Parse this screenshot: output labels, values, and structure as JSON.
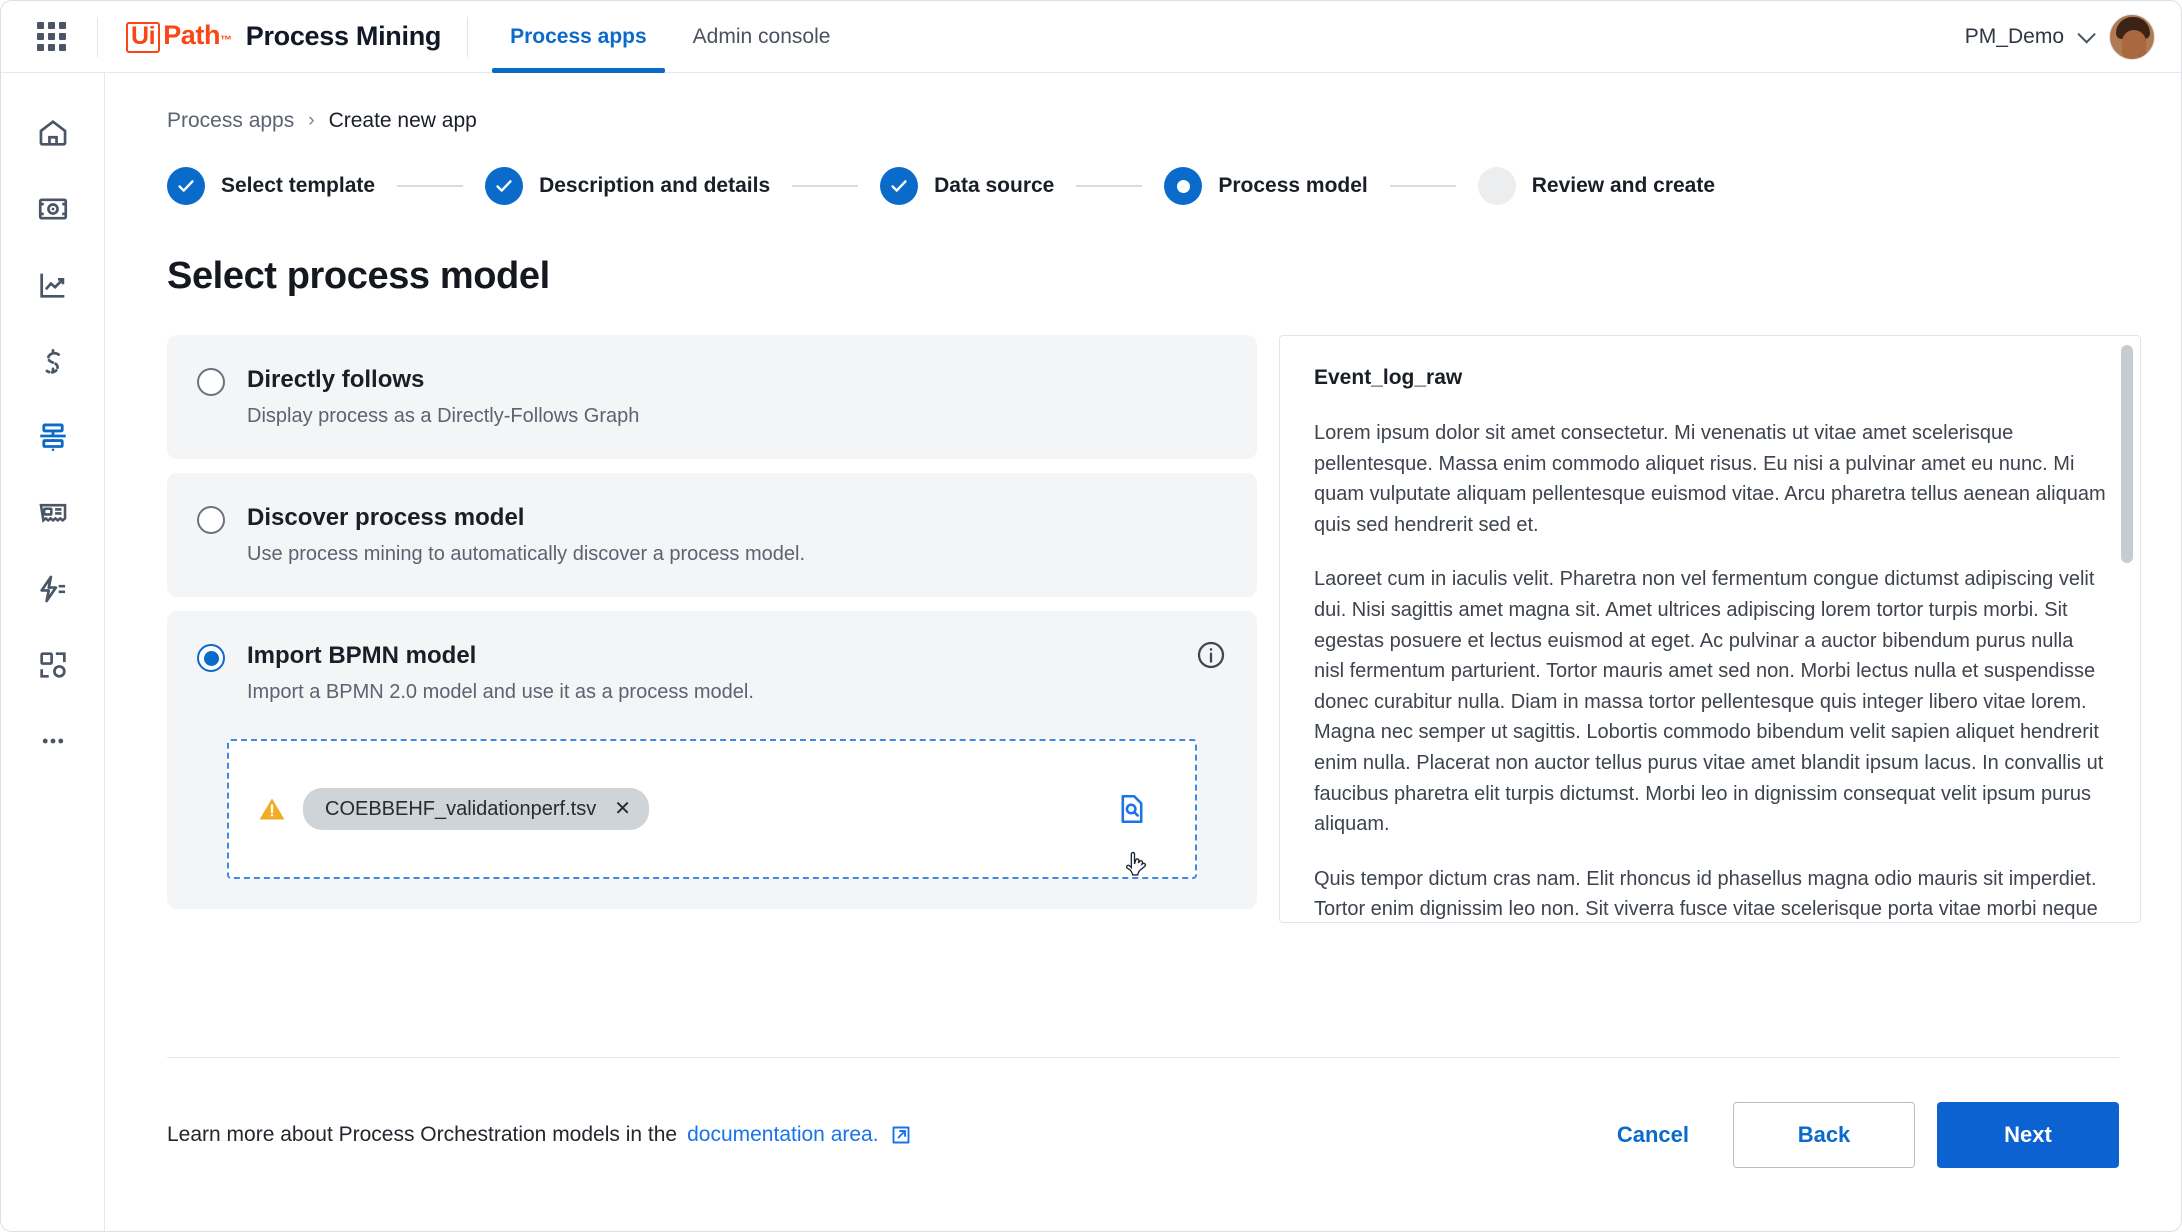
{
  "topbar": {
    "apps_grid_icon": "grid-apps-icon",
    "brand": {
      "ui": "Ui",
      "path": "Path",
      "tm": "™",
      "product": "Process Mining"
    },
    "tabs": [
      {
        "label": "Process apps",
        "active": true
      },
      {
        "label": "Admin console",
        "active": false
      }
    ],
    "account": {
      "name": "PM_Demo",
      "chevron_icon": "chevron-down-icon",
      "avatar_icon": "user-avatar"
    }
  },
  "rail": {
    "items": [
      {
        "icon": "home-icon",
        "active": false
      },
      {
        "icon": "discovery-eye-icon",
        "active": false
      },
      {
        "icon": "analytics-chart-icon",
        "active": false
      },
      {
        "icon": "savings-dollar-icon",
        "active": false
      },
      {
        "icon": "process-apps-icon",
        "active": true
      },
      {
        "icon": "invoice-receipt-icon",
        "active": false
      },
      {
        "icon": "automation-bolt-icon",
        "active": false
      },
      {
        "icon": "integrations-icon",
        "active": false
      },
      {
        "icon": "more-ellipsis-icon",
        "active": false
      }
    ]
  },
  "breadcrumb": {
    "root": "Process apps",
    "separator": "›",
    "current": "Create new app"
  },
  "stepper": {
    "steps": [
      {
        "label": "Select template",
        "state": "done"
      },
      {
        "label": "Description and details",
        "state": "done"
      },
      {
        "label": "Data source",
        "state": "done"
      },
      {
        "label": "Process model",
        "state": "current"
      },
      {
        "label": "Review and create",
        "state": "todo"
      }
    ]
  },
  "page_title": "Select process model",
  "options": [
    {
      "title": "Directly follows",
      "desc": "Display process as a Directly-Follows Graph",
      "selected": false
    },
    {
      "title": "Discover process model",
      "desc": "Use process mining to automatically discover a process model.",
      "selected": false
    },
    {
      "title": "Import BPMN model",
      "desc": "Import a BPMN 2.0 model and use it as a process model.",
      "selected": true,
      "info_icon": "info-circle-icon"
    }
  ],
  "dropzone": {
    "warning_icon": "warning-triangle-icon",
    "file_name": "COEBBEHF_validationperf.tsv",
    "remove_label": "✕",
    "preview_icon": "document-search-icon",
    "cursor_icon": "pointer-hand-cursor"
  },
  "preview": {
    "title": "Event_log_raw",
    "paragraphs": [
      "Lorem ipsum dolor sit amet consectetur. Mi venenatis ut vitae amet scelerisque pellentesque. Massa enim commodo aliquet risus. Eu nisi a pulvinar amet eu nunc. Mi quam vulputate aliquam pellentesque euismod vitae. Arcu pharetra tellus aenean aliquam quis sed hendrerit sed et.",
      "Laoreet cum in iaculis velit. Pharetra non vel fermentum congue dictumst adipiscing velit dui. Nisi sagittis amet magna sit. Amet ultrices adipiscing lorem tortor turpis morbi. Sit egestas posuere et lectus euismod at eget. Ac pulvinar a auctor bibendum purus nulla nisl fermentum parturient. Tortor mauris amet sed non. Morbi lectus nulla et suspendisse donec curabitur nulla. Diam in massa tortor pellentesque quis integer libero vitae lorem. Magna nec semper ut sagittis. Lobortis commodo bibendum velit sapien aliquet hendrerit enim nulla. Placerat non auctor tellus purus vitae amet blandit ipsum lacus. In convallis ut faucibus pharetra elit turpis dictumst. Morbi leo in dignissim consequat velit ipsum purus aliquam.",
      "Quis tempor dictum cras nam. Elit rhoncus id phasellus magna odio mauris sit imperdiet. Tortor enim dignissim leo non. Sit viverra fusce vitae scelerisque porta vitae morbi neque id. Vulputate commodo a maecenas amet lectus senectus volutpat urna."
    ]
  },
  "footer": {
    "learn_prefix": "Learn more about Process Orchestration models in the",
    "learn_link": "documentation area.",
    "external_icon": "external-link-icon",
    "cancel_label": "Cancel",
    "back_label": "Back",
    "next_label": "Next"
  },
  "colors": {
    "brand_orange": "#fa4616",
    "accent_blue": "#0b6bcb",
    "primary_button": "#0b62d0",
    "warning_yellow": "#f2ab27"
  }
}
